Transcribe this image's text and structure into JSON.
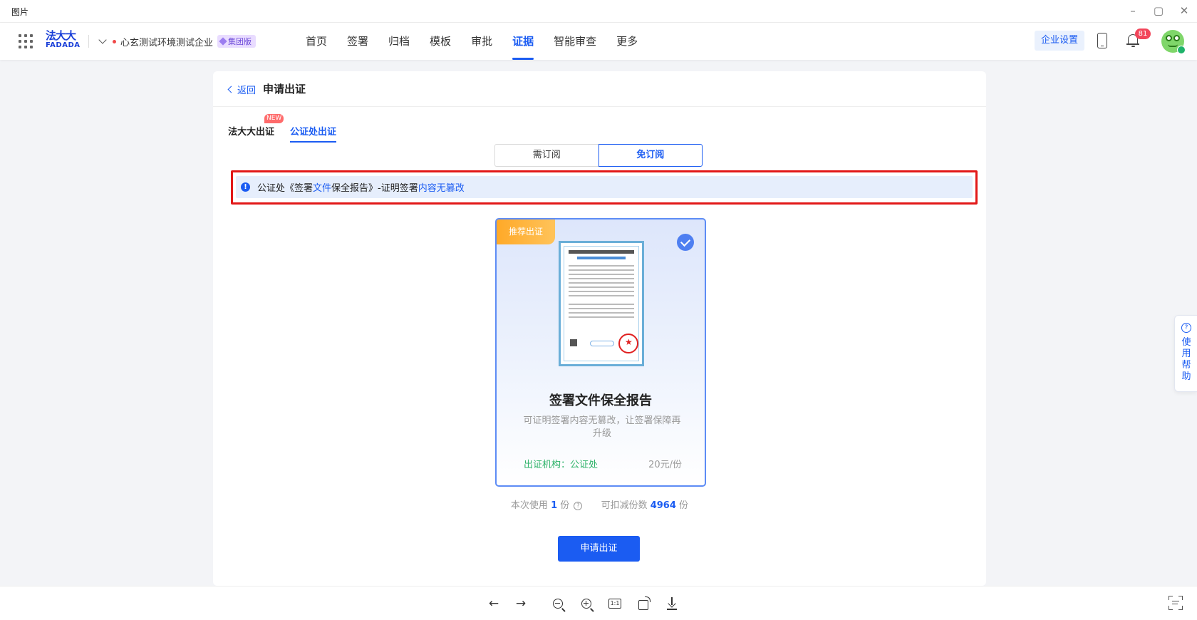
{
  "window": {
    "title": "图片"
  },
  "header": {
    "logo_cn": "法大大",
    "logo_en": "FADADA",
    "company": "心玄测试环境测试企业",
    "company_badge": "集团版",
    "nav": [
      "首页",
      "签署",
      "归档",
      "模板",
      "审批",
      "证据",
      "智能审查",
      "更多"
    ],
    "active_nav": "证据",
    "enterprise_settings": "企业设置",
    "notification_count": "81"
  },
  "page": {
    "back_label": "返回",
    "title": "申请出证",
    "tabs": [
      {
        "label": "法大大出证",
        "badge": "NEW"
      },
      {
        "label": "公证处出证"
      }
    ],
    "segment": [
      "需订阅",
      "免订阅"
    ],
    "notice": {
      "prefix": "公证处《签署",
      "hl1": "文件",
      "middle": "保全报告》-证明签署",
      "hl2": "内容无篡改"
    },
    "product": {
      "ribbon": "推荐出证",
      "name": "签署文件保全报告",
      "description": "可证明签署内容无篡改，让签署保障再升级",
      "org": "出证机构：公证处",
      "price": "20元/份"
    },
    "usage": {
      "use_prefix": "本次使用",
      "use_count": "1",
      "use_unit": "份",
      "deduct_prefix": "可扣减份数",
      "deduct_count": "4964",
      "deduct_unit": "份"
    },
    "apply_button": "申请出证"
  },
  "help": {
    "label": "使用帮助"
  },
  "colors": {
    "accent": "#1b5cf2",
    "highlight_border": "#e21818",
    "ribbon": "#ffa928",
    "org_green": "#2fb36a"
  }
}
